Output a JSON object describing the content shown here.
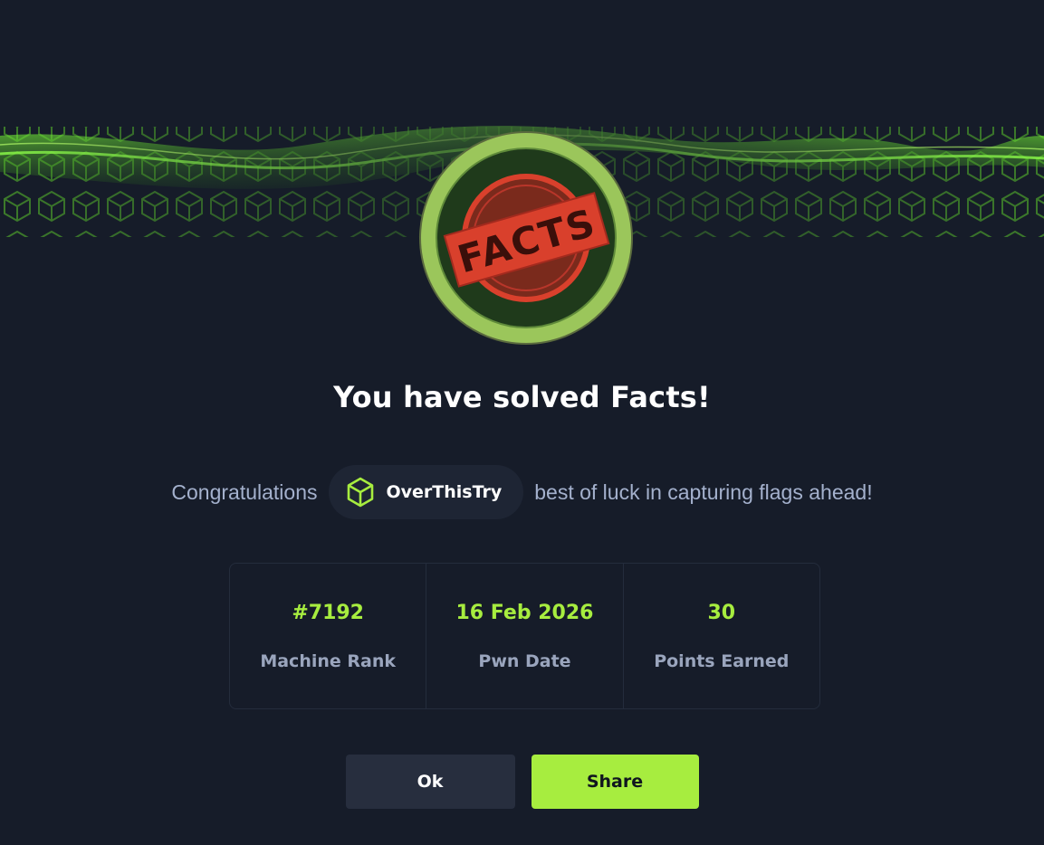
{
  "machine": {
    "name": "Facts",
    "badge_text": "FACTS"
  },
  "title": "You have solved Facts!",
  "congrats": {
    "prefix": "Congratulations",
    "username": "OverThisTry",
    "suffix": "best of luck in capturing flags ahead!"
  },
  "stats": [
    {
      "value": "#7192",
      "label": "Machine Rank"
    },
    {
      "value": "16 Feb 2026",
      "label": "Pwn Date"
    },
    {
      "value": "30",
      "label": "Points Earned"
    }
  ],
  "buttons": {
    "ok": "Ok",
    "share": "Share"
  },
  "colors": {
    "background": "#161c29",
    "accent": "#a7ed3f",
    "ok_button": "#272e3e",
    "badge_red": "#d9402c"
  },
  "icons": {
    "user_avatar": "cube-icon"
  }
}
